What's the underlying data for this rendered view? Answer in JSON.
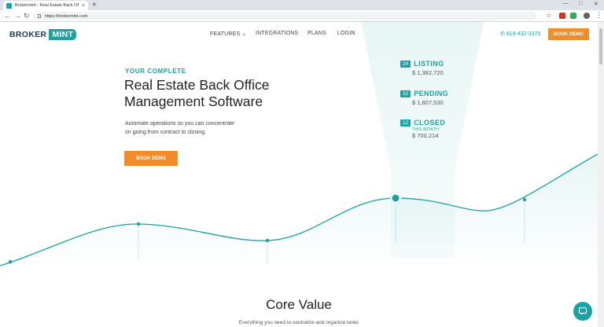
{
  "browser": {
    "tab_title": "Brokermint - Real Estate Back Of",
    "tab_close": "×",
    "new_tab": "+",
    "url": "https://brokermint.com"
  },
  "header": {
    "logo_broker": "BROKER",
    "logo_mint": "MINT",
    "nav": [
      {
        "label": "FEATURES ⌄"
      },
      {
        "label": "INTEGRATIONS"
      },
      {
        "label": "PLANS"
      },
      {
        "label": "LOGIN"
      }
    ],
    "phone": "619-432-3375",
    "cta": "BOOK DEMO"
  },
  "hero": {
    "kicker": "YOUR COMPLETE",
    "title_line1": "Real Estate Back Office",
    "title_line2": "Management Software",
    "sub_line1": "Automate operations so you can concentrate",
    "sub_line2": "on going from contract to closing.",
    "cta": "BOOK DEMO"
  },
  "stats": [
    {
      "count": "24",
      "label": "LISTING",
      "amount": "$ 1,382,720"
    },
    {
      "count": "32",
      "label": "PENDING",
      "amount": "$ 1,807,530"
    },
    {
      "count": "12",
      "label": "CLOSED",
      "note": "THIS MONTH",
      "amount": "$ 700,214"
    }
  ],
  "core": {
    "title": "Core Value",
    "subtitle": "Everything you need to centralize and organize tasks"
  },
  "colors": {
    "accent": "#1aa3a3",
    "cta": "#f28c28",
    "spotlight": "#e8f6f6"
  }
}
